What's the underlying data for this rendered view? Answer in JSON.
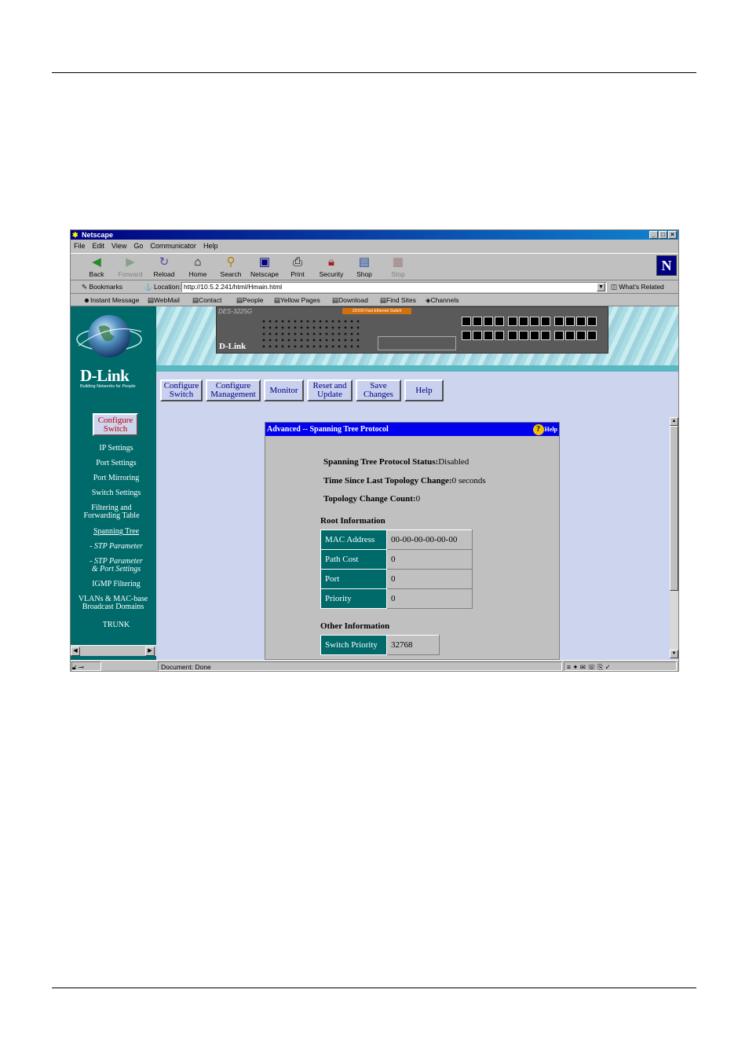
{
  "window": {
    "title": "Netscape"
  },
  "menu": [
    "File",
    "Edit",
    "View",
    "Go",
    "Communicator",
    "Help"
  ],
  "toolbar": {
    "buttons": [
      {
        "label": "Back",
        "icon": "back-arrow-icon"
      },
      {
        "label": "Forward",
        "icon": "forward-arrow-icon"
      },
      {
        "label": "Reload",
        "icon": "reload-icon"
      },
      {
        "label": "Home",
        "icon": "home-icon"
      },
      {
        "label": "Search",
        "icon": "search-icon"
      },
      {
        "label": "Netscape",
        "icon": "netscape-icon"
      },
      {
        "label": "Print",
        "icon": "print-icon"
      },
      {
        "label": "Security",
        "icon": "lock-icon"
      },
      {
        "label": "Shop",
        "icon": "shop-icon"
      },
      {
        "label": "Stop",
        "icon": "stop-icon"
      }
    ]
  },
  "location": {
    "bookmarks_label": "Bookmarks",
    "location_label": "Location:",
    "url": "http://10.5.2.241/html/Hmain.html",
    "whats_related": "What's Related"
  },
  "personal_toolbar": [
    "Instant Message",
    "WebMail",
    "Contact",
    "People",
    "Yellow Pages",
    "Download",
    "Find Sites",
    "Channels"
  ],
  "brand": {
    "name": "D-Link",
    "tagline": "Building Networks for People"
  },
  "device": {
    "model": "DES-3225G",
    "brand": "D-Link",
    "label": "10/100 Fast Ethernet Switch"
  },
  "top_buttons": [
    {
      "line1": "Configure",
      "line2": "Switch"
    },
    {
      "line1": "Configure",
      "line2": "Management"
    },
    {
      "line1": "Monitor",
      "line2": ""
    },
    {
      "line1": "Reset and",
      "line2": "Update"
    },
    {
      "line1": "Save",
      "line2": "Changes"
    },
    {
      "line1": "Help",
      "line2": ""
    }
  ],
  "sidebar": {
    "active": {
      "line1": "Configure",
      "line2": "Switch"
    },
    "items": [
      {
        "line1": "IP Settings",
        "line2": ""
      },
      {
        "line1": "Port Settings",
        "line2": ""
      },
      {
        "line1": "Port Mirroring",
        "line2": ""
      },
      {
        "line1": "Switch Settings",
        "line2": ""
      },
      {
        "line1": "Filtering and",
        "line2": "Forwarding Table"
      },
      {
        "line1": "Spanning Tree",
        "line2": ""
      },
      {
        "line1": "-  STP Parameter",
        "line2": ""
      },
      {
        "line1": "-  STP Parameter",
        "line2": "& Port Settings"
      },
      {
        "line1": "IGMP Filtering",
        "line2": ""
      },
      {
        "line1": "VLANs & MAC-base",
        "line2": "Broadcast Domains"
      },
      {
        "line1": "TRUNK",
        "line2": ""
      }
    ]
  },
  "panel": {
    "title": "Advanced -- Spanning Tree Protocol",
    "help": "Help",
    "status_label": "Spanning Tree Protocol Status:",
    "status_value": "Disabled",
    "time_label": "Time Since Last Topology Change:",
    "time_value": "0 seconds",
    "count_label": "Topology Change Count:",
    "count_value": "0",
    "root_title": "Root Information",
    "root_rows": [
      {
        "key": "MAC Address",
        "value": "00-00-00-00-00-00"
      },
      {
        "key": "Path Cost",
        "value": "0"
      },
      {
        "key": "Port",
        "value": "0"
      },
      {
        "key": "Priority",
        "value": "0"
      }
    ],
    "other_title": "Other Information",
    "other_rows": [
      {
        "key": "Switch Priority",
        "value": "32768"
      }
    ]
  },
  "status": {
    "text": "Document: Done"
  }
}
